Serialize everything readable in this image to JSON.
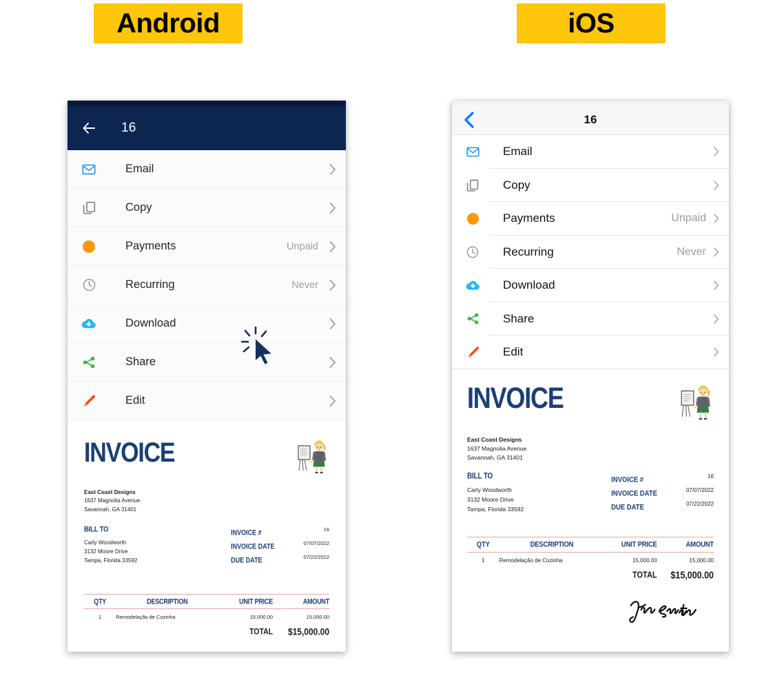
{
  "badges": {
    "android": "Android",
    "ios": "iOS",
    "background_color": "#FFC60B",
    "text_color": "#000000"
  },
  "android": {
    "appbar": {
      "back_icon": "arrow-left-icon",
      "title": "16",
      "background_color": "#0d2651",
      "text_color": "#ffffff"
    },
    "rows": [
      {
        "icon": "envelope-icon",
        "icon_color": "#2196F3",
        "label": "Email",
        "value": "",
        "chevron": "chevron-right-icon"
      },
      {
        "icon": "copy-icon",
        "icon_color": "#757575",
        "label": "Copy",
        "value": "",
        "chevron": "chevron-right-icon"
      },
      {
        "icon": "circle-dot-icon",
        "icon_color": "#FF9800",
        "label": "Payments",
        "value": "Unpaid",
        "chevron": "chevron-right-icon"
      },
      {
        "icon": "clock-icon",
        "icon_color": "#8E9196",
        "label": "Recurring",
        "value": "Never",
        "chevron": "chevron-right-icon"
      },
      {
        "icon": "cloud-download-icon",
        "icon_color": "#29B6F6",
        "label": "Download",
        "value": "",
        "chevron": "chevron-right-icon"
      },
      {
        "icon": "share-icon",
        "icon_color": "#4CAF50",
        "label": "Share",
        "value": "",
        "chevron": "chevron-right-icon"
      },
      {
        "icon": "pencil-icon",
        "icon_color": "#F4511E",
        "label": "Edit",
        "value": "",
        "chevron": "chevron-right-icon"
      }
    ]
  },
  "ios": {
    "appbar": {
      "back_icon": "chevron-left-icon",
      "back_icon_color": "#0a7cff",
      "title": "16",
      "background_color": "#f7f7f7",
      "text_color": "#111111"
    },
    "rows": [
      {
        "icon": "envelope-icon",
        "icon_color": "#2196F3",
        "label": "Email",
        "value": "",
        "chevron": "chevron-right-icon"
      },
      {
        "icon": "copy-icon",
        "icon_color": "#757575",
        "label": "Copy",
        "value": "",
        "chevron": "chevron-right-icon"
      },
      {
        "icon": "circle-dot-icon",
        "icon_color": "#FF9800",
        "label": "Payments",
        "value": "Unpaid",
        "chevron": "chevron-right-icon"
      },
      {
        "icon": "clock-icon",
        "icon_color": "#8E9196",
        "label": "Recurring",
        "value": "Never",
        "chevron": "chevron-right-icon"
      },
      {
        "icon": "cloud-download-icon",
        "icon_color": "#29B6F6",
        "label": "Download",
        "value": "",
        "chevron": "chevron-right-icon"
      },
      {
        "icon": "share-icon",
        "icon_color": "#4CAF50",
        "label": "Share",
        "value": "",
        "chevron": "chevron-right-icon"
      },
      {
        "icon": "pencil-icon",
        "icon_color": "#F4511E",
        "label": "Edit",
        "value": "",
        "chevron": "chevron-right-icon"
      }
    ]
  },
  "invoice": {
    "heading": "INVOICE",
    "accent_color": "#1b3f75",
    "rule_color": "#f0a3a3",
    "illustration": "woman-at-easel-illustration",
    "from": {
      "company": "East Coast Designs",
      "address_line1": "1637 Magnolia Avenue",
      "address_line2": "Savannah, GA 31401"
    },
    "bill_to": {
      "heading": "BILL TO",
      "name": "Carly Woodworth",
      "address_line1": "3132 Moore Drive",
      "address_line2": "Tampa, Florida 33592"
    },
    "meta": [
      {
        "key": "INVOICE #",
        "value": "16"
      },
      {
        "key": "INVOICE DATE",
        "value": "07/07/2022"
      },
      {
        "key": "DUE DATE",
        "value": "07/22/2022"
      }
    ],
    "columns": [
      "QTY",
      "DESCRIPTION",
      "UNIT PRICE",
      "AMOUNT"
    ],
    "line_items": [
      {
        "qty": "1",
        "description": "Remodelação de Cozinha",
        "unit_price": "15,000.00",
        "amount": "15,000.00"
      }
    ],
    "total_label": "TOTAL",
    "total_value": "$15,000.00",
    "signature": "John Smith"
  },
  "cursor": {
    "name": "mouse-pointer-click",
    "color": "#17315c"
  }
}
